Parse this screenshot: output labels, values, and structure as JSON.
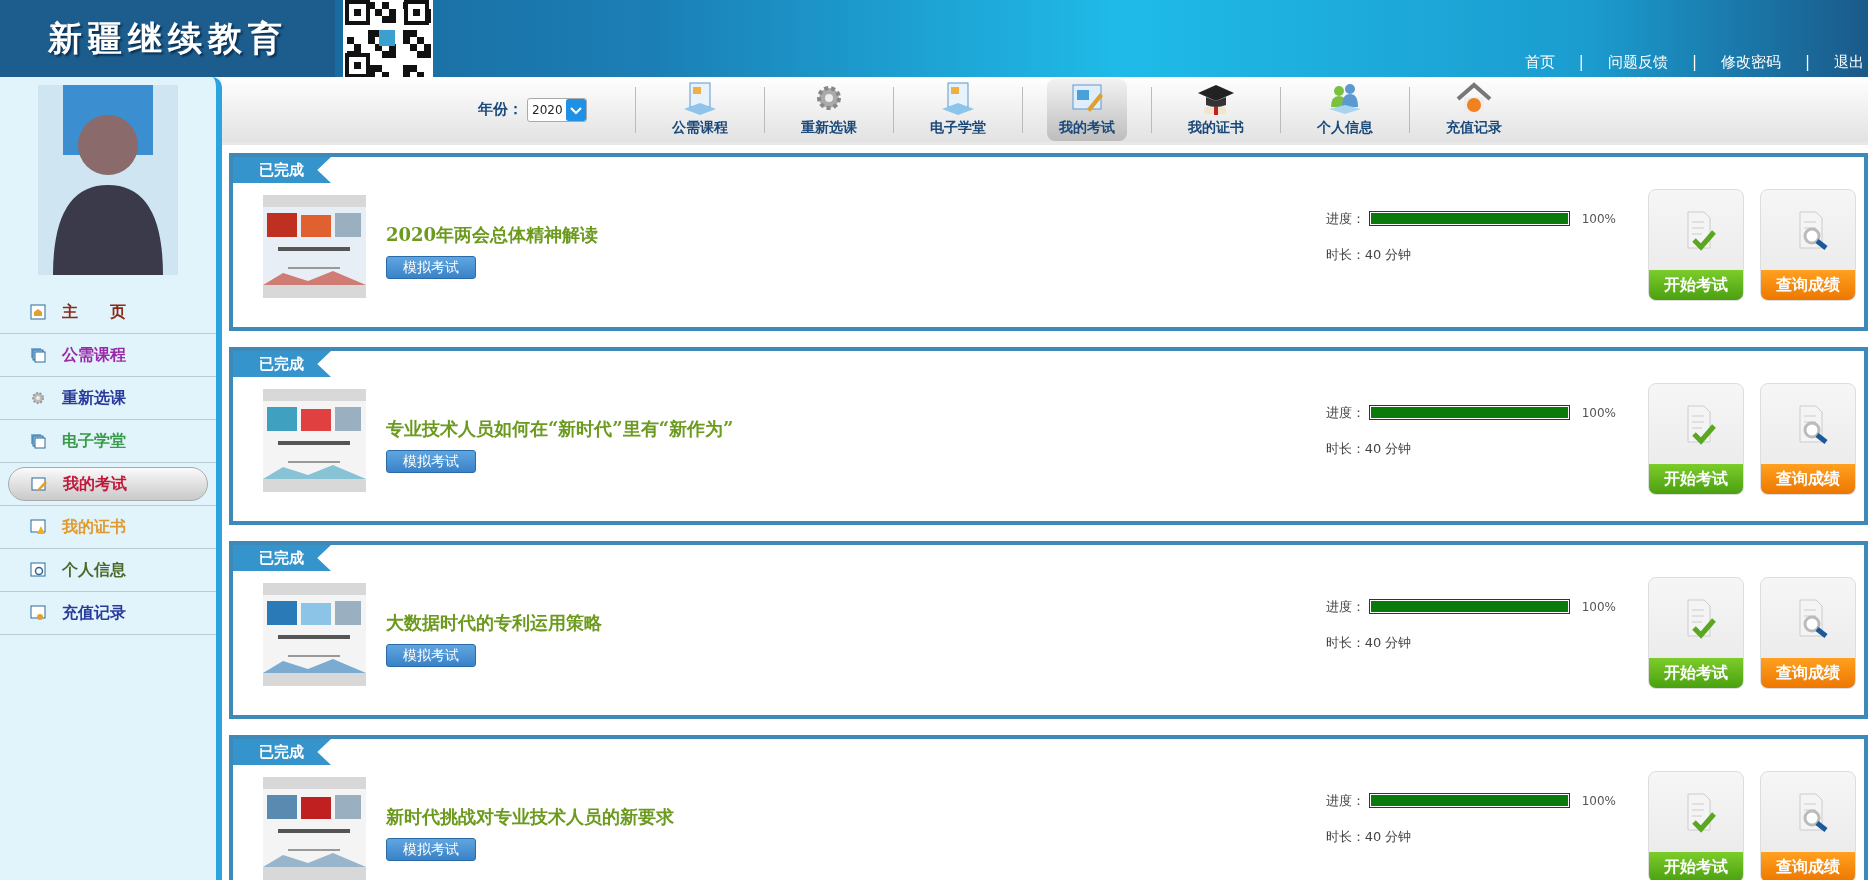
{
  "header": {
    "logo": "新疆继续教育",
    "links": [
      {
        "label": "首页"
      },
      {
        "label": "问题反馈"
      },
      {
        "label": "修改密码"
      },
      {
        "label": "退出"
      }
    ],
    "separator": "|"
  },
  "sidebar": {
    "items": [
      {
        "label": "主　　页",
        "kind": "home",
        "color": "#8b2a1a",
        "selected": false
      },
      {
        "label": "公需课程",
        "kind": "windows",
        "color": "#9b2aa8",
        "selected": false
      },
      {
        "label": "重新选课",
        "kind": "gear",
        "color": "#2a3a9b",
        "selected": false
      },
      {
        "label": "电子学堂",
        "kind": "windows",
        "color": "#3a9b4a",
        "selected": false
      },
      {
        "label": "我的考试",
        "kind": "pencil",
        "color": "#c0183a",
        "selected": true
      },
      {
        "label": "我的证书",
        "kind": "warning",
        "color": "#e09a30",
        "selected": false
      },
      {
        "label": "个人信息",
        "kind": "search",
        "color": "#4a6a2a",
        "selected": false
      },
      {
        "label": "充值记录",
        "kind": "key",
        "color": "#2a3a9b",
        "selected": false
      }
    ]
  },
  "toolbar": {
    "year_label": "年份：",
    "year_value": "2020",
    "items": [
      {
        "label": "公需课程",
        "kind": "doc",
        "selected": false
      },
      {
        "label": "重新选课",
        "kind": "gear",
        "selected": false
      },
      {
        "label": "电子学堂",
        "kind": "doc",
        "selected": false
      },
      {
        "label": "我的考试",
        "kind": "exam",
        "selected": true
      },
      {
        "label": "我的证书",
        "kind": "cap",
        "selected": false
      },
      {
        "label": "个人信息",
        "kind": "people",
        "selected": false
      },
      {
        "label": "充值记录",
        "kind": "house",
        "selected": false
      }
    ]
  },
  "exams": [
    {
      "status": "已完成",
      "title": "2020年两会总体精神解读",
      "mock_button": "模拟考试",
      "progress_label": "进度：",
      "level": 1,
      "reading": "100%",
      "duration": "时长：40 分钟",
      "start_button": "开始考试",
      "score_button": "查询成绩"
    },
    {
      "status": "已完成",
      "title": "专业技术人员如何在“新时代”里有“新作为”",
      "mock_button": "模拟考试",
      "progress_label": "进度：",
      "level": 1,
      "reading": "100%",
      "duration": "时长：40 分钟",
      "start_button": "开始考试",
      "score_button": "查询成绩"
    },
    {
      "status": "已完成",
      "title": "大数据时代的专利运用策略",
      "mock_button": "模拟考试",
      "progress_label": "进度：",
      "level": 1,
      "reading": "100%",
      "duration": "时长：40 分钟",
      "start_button": "开始考试",
      "score_button": "查询成绩"
    },
    {
      "status": "已完成",
      "title": "新时代挑战对专业技术人员的新要求",
      "mock_button": "模拟考试",
      "progress_label": "进度：",
      "level": 1,
      "reading": "100%",
      "duration": "时长：40 分钟",
      "start_button": "开始考试",
      "score_button": "查询成绩"
    }
  ]
}
